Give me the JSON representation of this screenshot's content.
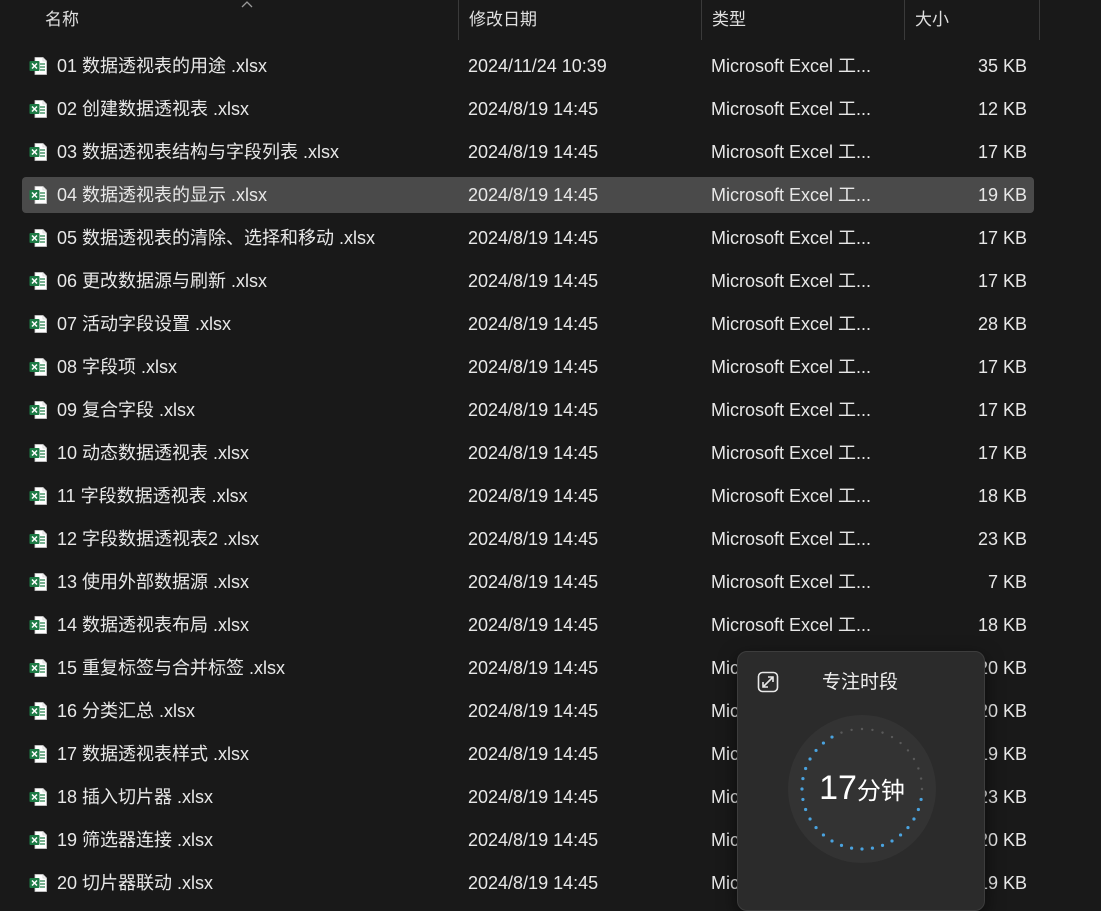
{
  "columns": {
    "name": "名称",
    "modified": "修改日期",
    "type": "类型",
    "size": "大小"
  },
  "files": [
    {
      "name": "01  数据透视表的用途 .xlsx",
      "modified": "2024/11/24 10:39",
      "type": "Microsoft Excel 工...",
      "size": "35 KB"
    },
    {
      "name": "02  创建数据透视表 .xlsx",
      "modified": "2024/8/19 14:45",
      "type": "Microsoft Excel 工...",
      "size": "12 KB"
    },
    {
      "name": "03  数据透视表结构与字段列表 .xlsx",
      "modified": "2024/8/19 14:45",
      "type": "Microsoft Excel 工...",
      "size": "17 KB"
    },
    {
      "name": "04  数据透视表的显示 .xlsx",
      "modified": "2024/8/19 14:45",
      "type": "Microsoft Excel 工...",
      "size": "19 KB",
      "selected": true
    },
    {
      "name": "05  数据透视表的清除、选择和移动 .xlsx",
      "modified": "2024/8/19 14:45",
      "type": "Microsoft Excel 工...",
      "size": "17 KB"
    },
    {
      "name": "06  更改数据源与刷新 .xlsx",
      "modified": "2024/8/19 14:45",
      "type": "Microsoft Excel 工...",
      "size": "17 KB"
    },
    {
      "name": "07  活动字段设置 .xlsx",
      "modified": "2024/8/19 14:45",
      "type": "Microsoft Excel 工...",
      "size": "28 KB"
    },
    {
      "name": "08  字段项 .xlsx",
      "modified": "2024/8/19 14:45",
      "type": "Microsoft Excel 工...",
      "size": "17 KB"
    },
    {
      "name": "09  复合字段 .xlsx",
      "modified": "2024/8/19 14:45",
      "type": "Microsoft Excel 工...",
      "size": "17 KB"
    },
    {
      "name": "10 动态数据透视表 .xlsx",
      "modified": "2024/8/19 14:45",
      "type": "Microsoft Excel 工...",
      "size": "17 KB"
    },
    {
      "name": "11 字段数据透视表 .xlsx",
      "modified": "2024/8/19 14:45",
      "type": "Microsoft Excel 工...",
      "size": "18 KB"
    },
    {
      "name": "12 字段数据透视表2 .xlsx",
      "modified": "2024/8/19 14:45",
      "type": "Microsoft Excel 工...",
      "size": "23 KB"
    },
    {
      "name": "13 使用外部数据源 .xlsx",
      "modified": "2024/8/19 14:45",
      "type": "Microsoft Excel 工...",
      "size": "7 KB"
    },
    {
      "name": "14  数据透视表布局 .xlsx",
      "modified": "2024/8/19 14:45",
      "type": "Microsoft Excel 工...",
      "size": "18 KB"
    },
    {
      "name": "15  重复标签与合并标签 .xlsx",
      "modified": "2024/8/19 14:45",
      "type": "Mic",
      "size": "20 KB"
    },
    {
      "name": "16  分类汇总 .xlsx",
      "modified": "2024/8/19 14:45",
      "type": "Mic",
      "size": "20 KB"
    },
    {
      "name": "17  数据透视表样式 .xlsx",
      "modified": "2024/8/19 14:45",
      "type": "Mic",
      "size": "19 KB"
    },
    {
      "name": "18  插入切片器 .xlsx",
      "modified": "2024/8/19 14:45",
      "type": "Mic",
      "size": "23 KB"
    },
    {
      "name": "19  筛选器连接 .xlsx",
      "modified": "2024/8/19 14:45",
      "type": "Mic",
      "size": "20 KB"
    },
    {
      "name": "20  切片器联动 .xlsx",
      "modified": "2024/8/19 14:45",
      "type": "Mic",
      "size": "19 KB"
    }
  ],
  "focus": {
    "title": "专注时段",
    "minutes": "17",
    "unit": "分钟",
    "icon": "expand-icon"
  },
  "colors": {
    "background": "#191919",
    "selected_row": "#4a4a4a",
    "excel_green": "#1d7a45",
    "timer_dot": "#4aa3df"
  }
}
